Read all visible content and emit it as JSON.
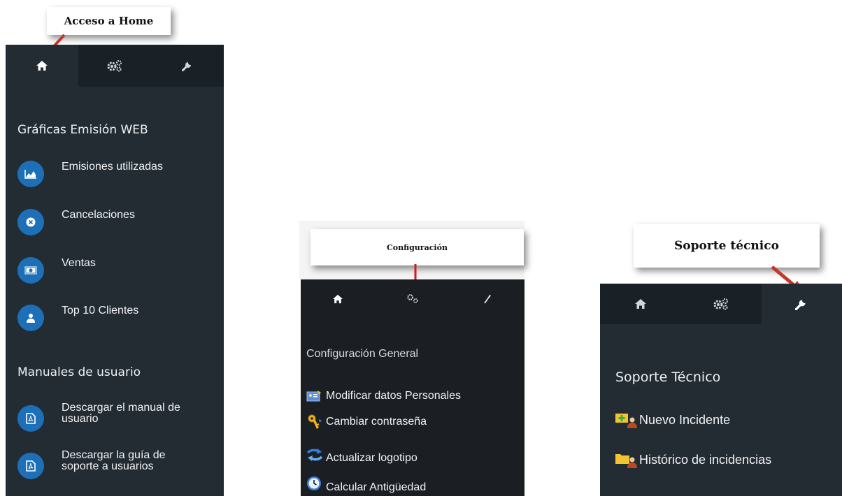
{
  "panel_home": {
    "callout": "Acceso a Home",
    "tabs": [
      {
        "icon": "home-icon"
      },
      {
        "icon": "gears-icon"
      },
      {
        "icon": "wrench-icon"
      }
    ],
    "section1_title": "Gráficas Emisión WEB",
    "items1": [
      {
        "label": "Emisiones utilizadas",
        "icon": "area-chart-icon"
      },
      {
        "label": "Cancelaciones",
        "icon": "cancel-circle-icon"
      },
      {
        "label": "Ventas",
        "icon": "money-icon"
      },
      {
        "label": "Top 10 Clientes",
        "icon": "users-icon"
      }
    ],
    "section2_title": "Manuales de usuario",
    "items2": [
      {
        "line1": "Descargar el manual de",
        "line2": "usuario",
        "icon": "pdf-icon"
      },
      {
        "line1": "Descargar la guía de",
        "line2": "soporte a usuarios",
        "icon": "pdf-icon"
      }
    ]
  },
  "panel_config": {
    "callout": "Configuración",
    "tabs": [
      {
        "icon": "home-icon"
      },
      {
        "icon": "gears-icon"
      },
      {
        "icon": "wrench-icon"
      }
    ],
    "section_title": "Configuración General",
    "items": [
      {
        "label": "Modificar datos Personales",
        "icon": "user-card-icon"
      },
      {
        "label": "Cambiar contraseña",
        "icon": "key-icon"
      },
      {
        "label": "Actualizar logotipo",
        "icon": "refresh-arrows-icon"
      },
      {
        "label": "Calcular Antigüedad",
        "icon": "clock-icon"
      }
    ]
  },
  "panel_support": {
    "callout": "Soporte técnico",
    "tabs": [
      {
        "icon": "home-icon"
      },
      {
        "icon": "gears-icon"
      },
      {
        "icon": "wrench-icon"
      }
    ],
    "section_title": "Soporte Técnico",
    "items": [
      {
        "label": "Nuevo Incidente",
        "icon": "new-incident-icon"
      },
      {
        "label": "Histórico de incidencias",
        "icon": "folder-user-icon"
      }
    ]
  },
  "colors": {
    "panel_bg": "#232c33",
    "tab_bg": "#1a2126",
    "circle_blue": "#1d70b8",
    "arrow_red": "#c0392b"
  }
}
